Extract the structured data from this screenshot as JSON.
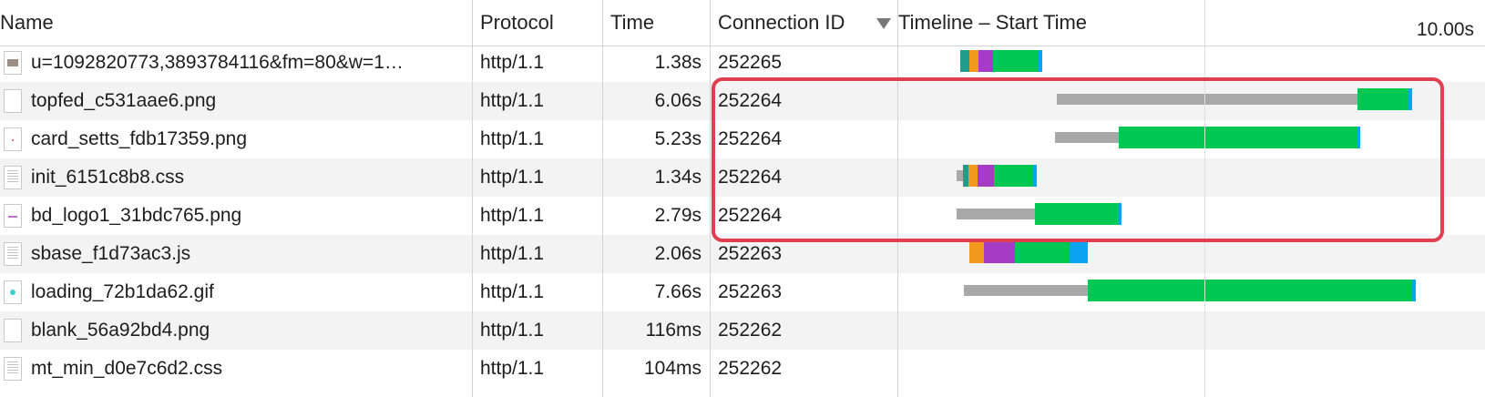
{
  "columns": {
    "name": "Name",
    "protocol": "Protocol",
    "time": "Time",
    "connection_id": "Connection ID",
    "timeline": "Timeline – Start Time",
    "timeline_scale": "10.00s"
  },
  "sort": {
    "column": "Connection ID",
    "direction": "descending",
    "icon": "sort-descending-icon"
  },
  "colors": {
    "stalled": "#a8a8a8",
    "dns": "#1f9c8b",
    "connect": "#f39a1e",
    "ssl": "#a63cc6",
    "waiting": "#00c853",
    "download": "#0aa4f0",
    "highlight": "#e03f4f"
  },
  "rows": [
    {
      "name": "u=1092820773,3893784116&fm=80&w=1…",
      "icon": "image-file-icon",
      "protocol": "http/1.1",
      "time": "1.38s",
      "connection_id": "252265"
    },
    {
      "name": "topfed_c531aae6.png",
      "icon": "image-file-icon",
      "protocol": "http/1.1",
      "time": "6.06s",
      "connection_id": "252264"
    },
    {
      "name": "card_setts_fdb17359.png",
      "icon": "image-file-icon",
      "protocol": "http/1.1",
      "time": "5.23s",
      "connection_id": "252264"
    },
    {
      "name": "init_6151c8b8.css",
      "icon": "css-file-icon",
      "protocol": "http/1.1",
      "time": "1.34s",
      "connection_id": "252264"
    },
    {
      "name": "bd_logo1_31bdc765.png",
      "icon": "image-file-icon",
      "protocol": "http/1.1",
      "time": "2.79s",
      "connection_id": "252264"
    },
    {
      "name": "sbase_f1d73ac3.js",
      "icon": "script-file-icon",
      "protocol": "http/1.1",
      "time": "2.06s",
      "connection_id": "252263"
    },
    {
      "name": "loading_72b1da62.gif",
      "icon": "gif-file-icon",
      "protocol": "http/1.1",
      "time": "7.66s",
      "connection_id": "252263"
    },
    {
      "name": "blank_56a92bd4.png",
      "icon": "blank-file-icon",
      "protocol": "http/1.1",
      "time": "116ms",
      "connection_id": "252262"
    },
    {
      "name": "mt_min_d0e7c6d2.css",
      "icon": "css-file-icon",
      "protocol": "http/1.1",
      "time": "104ms",
      "connection_id": "252262"
    }
  ]
}
